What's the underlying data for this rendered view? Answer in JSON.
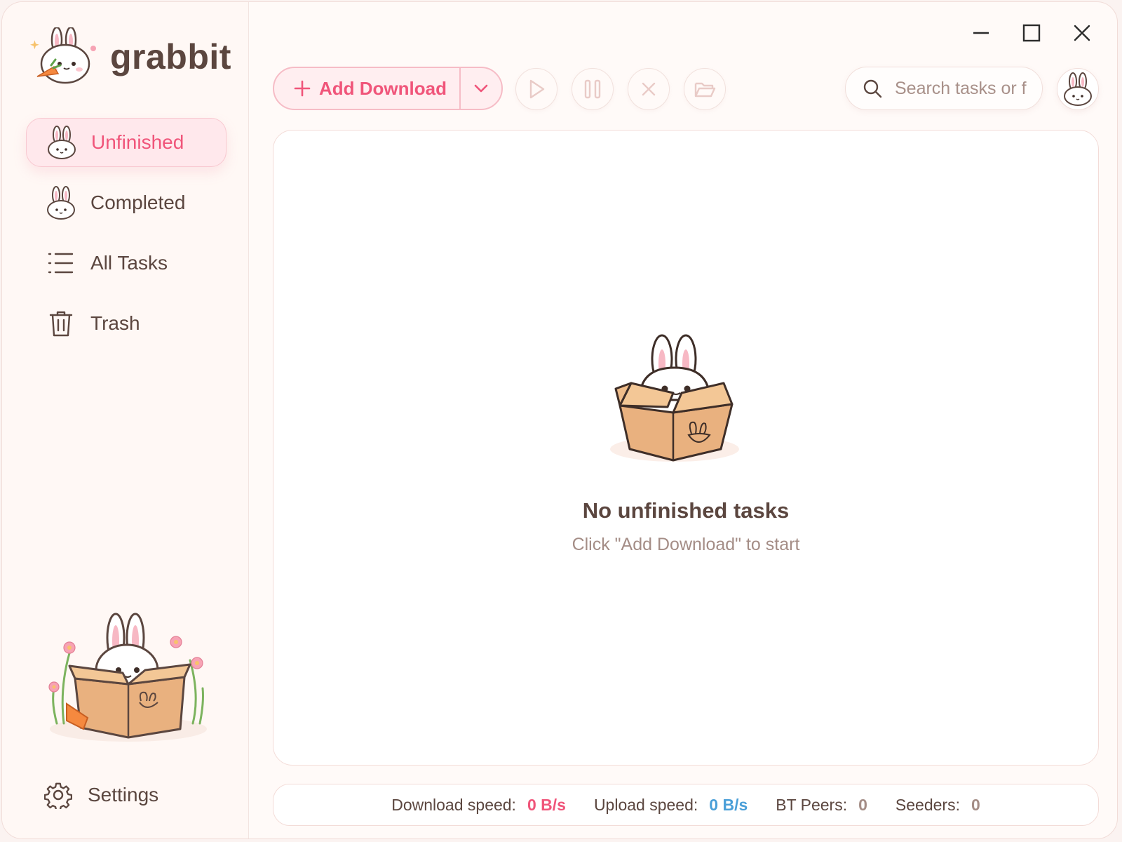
{
  "app": {
    "name": "grabbit"
  },
  "sidebar": {
    "items": [
      {
        "label": "Unfinished",
        "icon": "bunny-face-icon",
        "active": true
      },
      {
        "label": "Completed",
        "icon": "bunny-face-icon",
        "active": false
      },
      {
        "label": "All Tasks",
        "icon": "list-icon",
        "active": false
      },
      {
        "label": "Trash",
        "icon": "trash-icon",
        "active": false
      }
    ],
    "settings_label": "Settings"
  },
  "toolbar": {
    "add_download_label": "Add Download",
    "search_placeholder": "Search tasks or f"
  },
  "empty_state": {
    "title": "No unfinished tasks",
    "subtitle": "Click \"Add Download\" to start"
  },
  "status": {
    "download_label": "Download speed:",
    "download_value": "0 B/s",
    "upload_label": "Upload speed:",
    "upload_value": "0 B/s",
    "peers_label": "BT Peers:",
    "peers_value": "0",
    "seeders_label": "Seeders:",
    "seeders_value": "0"
  },
  "colors": {
    "accent": "#f0557a",
    "upload": "#4a9fd8",
    "text": "#5b463f",
    "muted": "#a48d86",
    "panel_border": "#f3dcd8"
  }
}
